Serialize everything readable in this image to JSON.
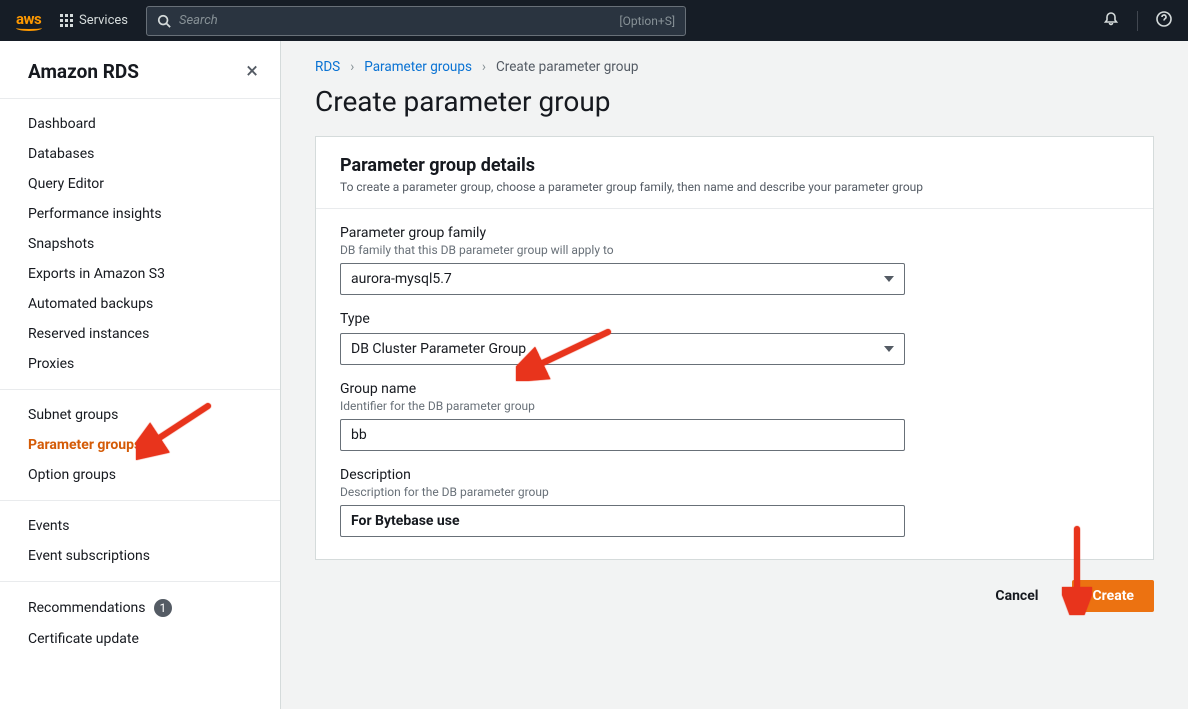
{
  "topbar": {
    "logo": "aws",
    "services_label": "Services",
    "search_placeholder": "Search",
    "search_shortcut": "[Option+S]"
  },
  "sidebar": {
    "title": "Amazon RDS",
    "section1": [
      "Dashboard",
      "Databases",
      "Query Editor",
      "Performance insights",
      "Snapshots",
      "Exports in Amazon S3",
      "Automated backups",
      "Reserved instances",
      "Proxies"
    ],
    "section2": [
      "Subnet groups",
      "Parameter groups",
      "Option groups"
    ],
    "section2_active": "Parameter groups",
    "section3": [
      "Events",
      "Event subscriptions"
    ],
    "section4": {
      "recommendations_label": "Recommendations",
      "recommendations_count": "1",
      "certificate_label": "Certificate update"
    }
  },
  "breadcrumb": {
    "items": [
      "RDS",
      "Parameter groups",
      "Create parameter group"
    ]
  },
  "page": {
    "title": "Create parameter group"
  },
  "panel": {
    "title": "Parameter group details",
    "description": "To create a parameter group, choose a parameter group family, then name and describe your parameter group",
    "family": {
      "label": "Parameter group family",
      "hint": "DB family that this DB parameter group will apply to",
      "value": "aurora-mysql5.7"
    },
    "type": {
      "label": "Type",
      "value": "DB Cluster Parameter Group"
    },
    "group_name": {
      "label": "Group name",
      "hint": "Identifier for the DB parameter group",
      "value": "bb"
    },
    "description_field": {
      "label": "Description",
      "hint": "Description for the DB parameter group",
      "value": "For Bytebase use"
    }
  },
  "actions": {
    "cancel": "Cancel",
    "create": "Create"
  }
}
